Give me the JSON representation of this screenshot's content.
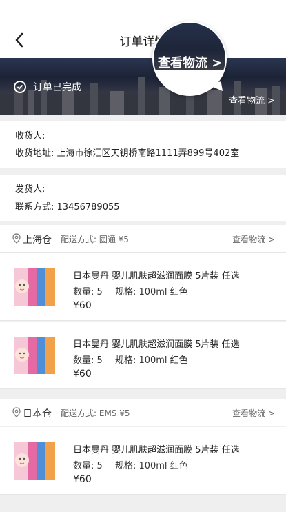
{
  "nav": {
    "title": "订单详情"
  },
  "banner": {
    "status": "订单已完成",
    "logistics_link": "查看物流 >",
    "magnifier_text": "查看物流 >"
  },
  "receiver": {
    "name_label": "收货人:",
    "address_label": "收货地址:",
    "address_value": "上海市徐汇区天钥桥南路1111弄899号402室"
  },
  "sender": {
    "name_label": "发货人:",
    "contact_label": "联系方式:",
    "contact_value": "13456789055"
  },
  "warehouses": [
    {
      "name": "上海仓",
      "shipping": "配送方式:  圆通    ¥5",
      "logistics": "查看物流 >",
      "items": [
        {
          "name": "日本曼丹 婴儿肌肤超滋润面膜 5片装 任选",
          "qty": "数量:  5",
          "spec": "规格:  100ml 红色",
          "price": "¥60"
        },
        {
          "name": "日本曼丹 婴儿肌肤超滋润面膜 5片装 任选",
          "qty": "数量:  5",
          "spec": "规格:  100ml 红色",
          "price": "¥60"
        }
      ]
    },
    {
      "name": "日本仓",
      "shipping": "配送方式:  EMS    ¥5",
      "logistics": "查看物流 >",
      "items": [
        {
          "name": "日本曼丹 婴儿肌肤超滋润面膜 5片装 任选",
          "qty": "数量:  5",
          "spec": "规格:  100ml 红色",
          "price": "¥60"
        }
      ]
    }
  ],
  "colors": {
    "banner": "#1c2336",
    "background": "#efefef",
    "text": "#222222"
  }
}
